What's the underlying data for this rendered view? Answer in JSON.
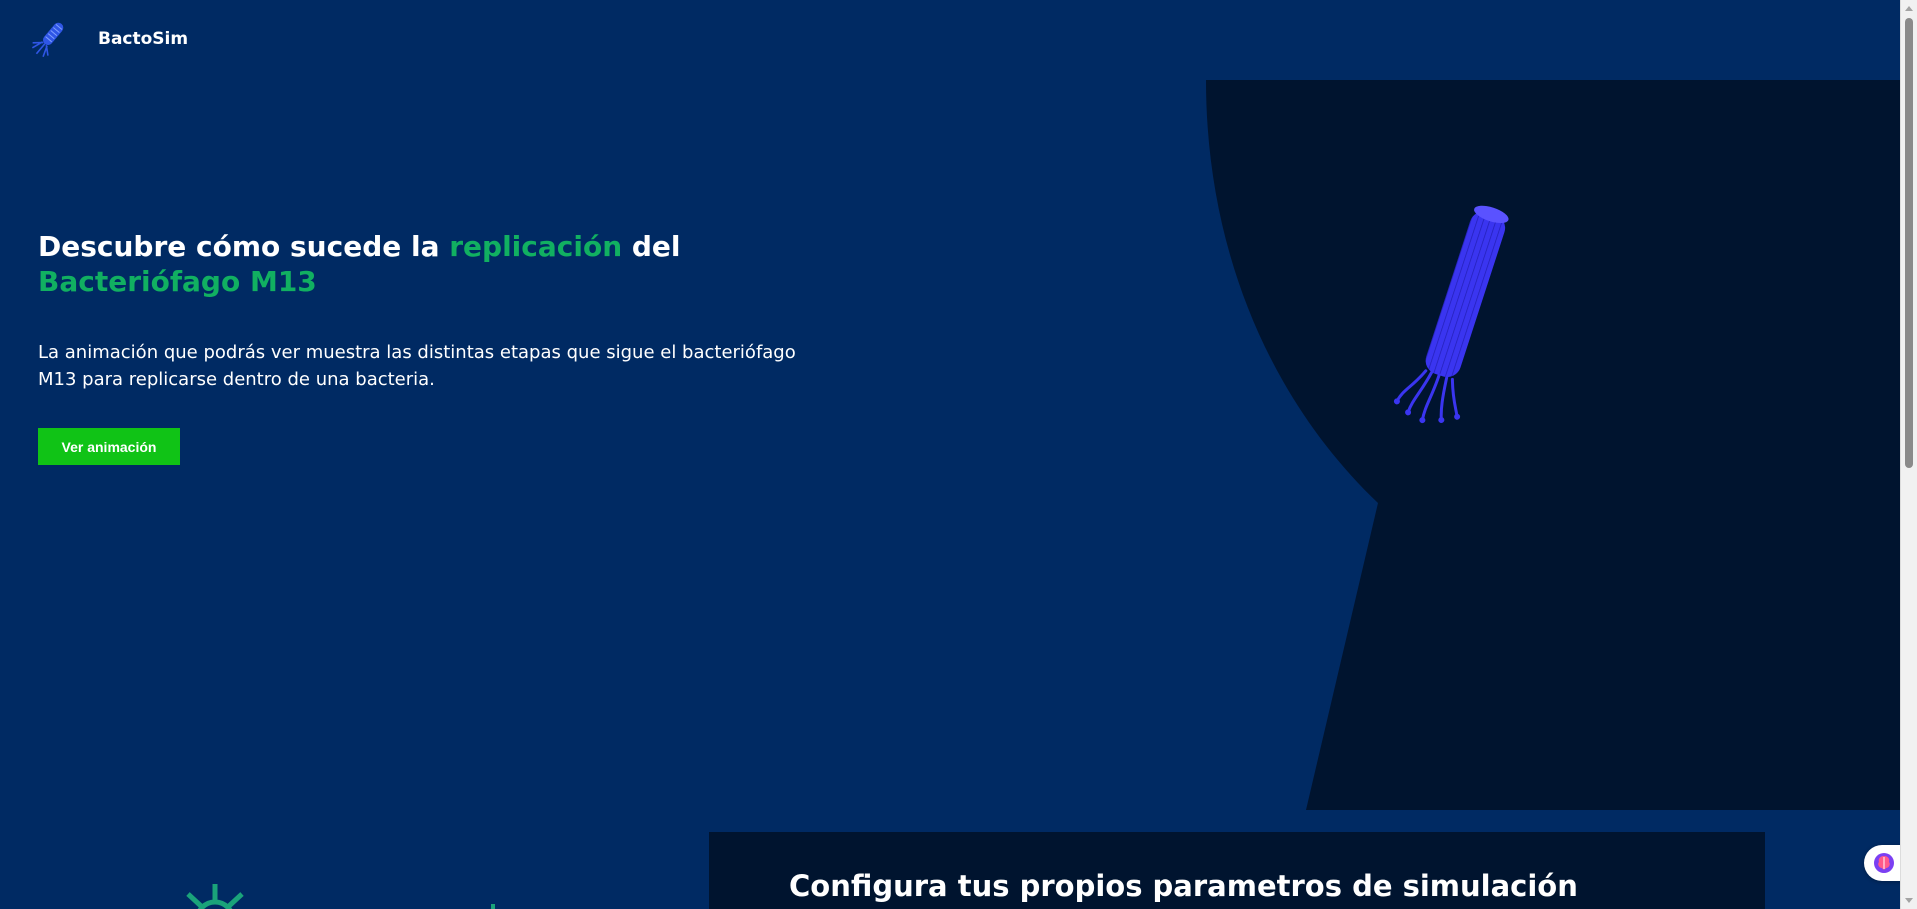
{
  "header": {
    "brand": "BactoSim",
    "logo_icon": "bacteriophage-logo-icon"
  },
  "hero": {
    "title_part1": "Descubre cómo sucede la ",
    "title_highlight1": "replicación",
    "title_part2": " del",
    "title_highlight2": "Bacteriófago M13",
    "description": "La animación que podrás ver muestra las distintas etapas que sigue el bacteriófago M13 para replicarse dentro de una bacteria.",
    "cta_label": "Ver animación",
    "visual_icon": "bacteriophage-3d-icon"
  },
  "config": {
    "title": "Configura tus propios parametros de simulación"
  },
  "floating": {
    "assistant_icon": "brain-icon"
  },
  "colors": {
    "background": "#002a63",
    "panel_dark": "#00142f",
    "highlight_green": "#11b061",
    "button_green": "#10c316",
    "phage_blue": "#3a35f0"
  }
}
